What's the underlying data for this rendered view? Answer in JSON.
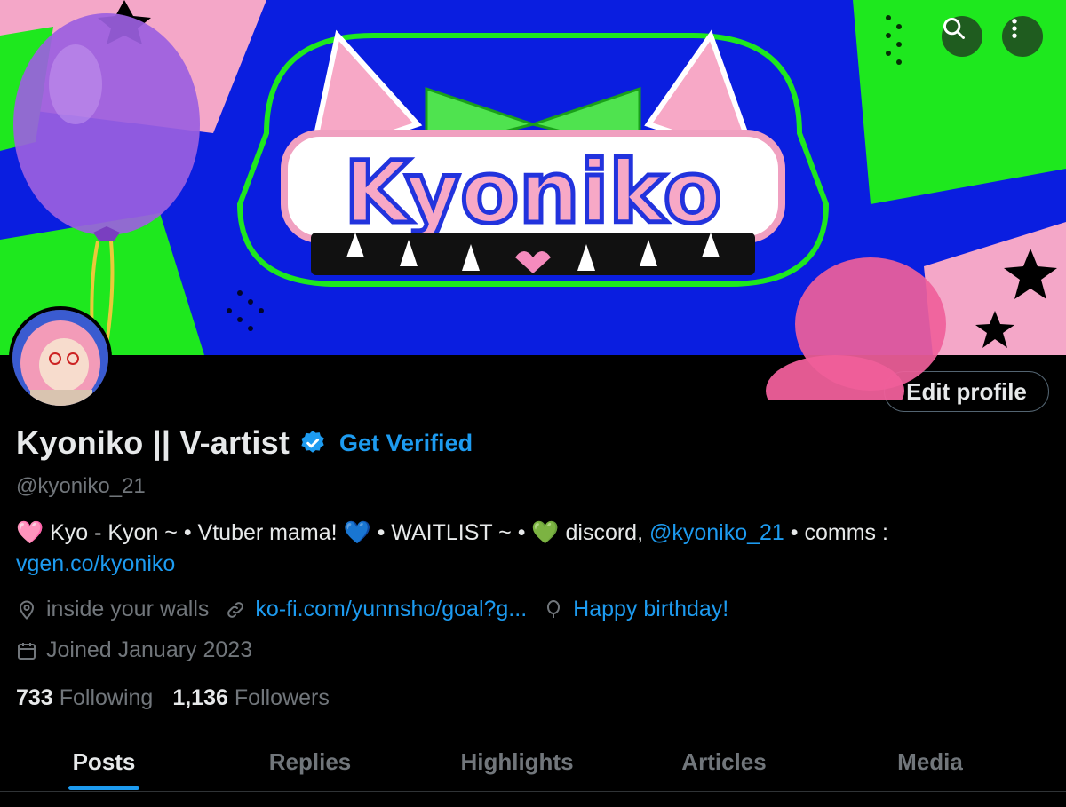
{
  "colors": {
    "accent": "#1d9bf0",
    "muted": "#71767b",
    "text": "#e7e9ea",
    "background": "#000000"
  },
  "banner": {
    "logo_text": "Kyoniko"
  },
  "header": {
    "search_icon": "search-icon",
    "more_icon": "more-vertical-icon"
  },
  "profile": {
    "edit_label": "Edit profile",
    "display_name": "Kyoniko || V-artist",
    "get_verified": "Get Verified",
    "handle": "@kyoniko_21",
    "bio": {
      "heart1": "🩷",
      "part1": " Kyo - Kyon ~ • Vtuber mama! ",
      "heart2": "💙",
      "part2": " • WAITLIST ~ • ",
      "heart3": "💚",
      "part3": " discord, ",
      "mention": "@kyoniko_21",
      "part4": " • comms : ",
      "link": "vgen.co/kyoniko"
    },
    "location": "inside your walls",
    "website": "ko-fi.com/yunnsho/goal?g...",
    "birthday": "Happy birthday!",
    "joined": "Joined January 2023",
    "following_count": "733",
    "following_label": "Following",
    "followers_count": "1,136",
    "followers_label": "Followers"
  },
  "tabs": [
    {
      "label": "Posts",
      "active": true
    },
    {
      "label": "Replies"
    },
    {
      "label": "Highlights"
    },
    {
      "label": "Articles"
    },
    {
      "label": "Media"
    }
  ]
}
